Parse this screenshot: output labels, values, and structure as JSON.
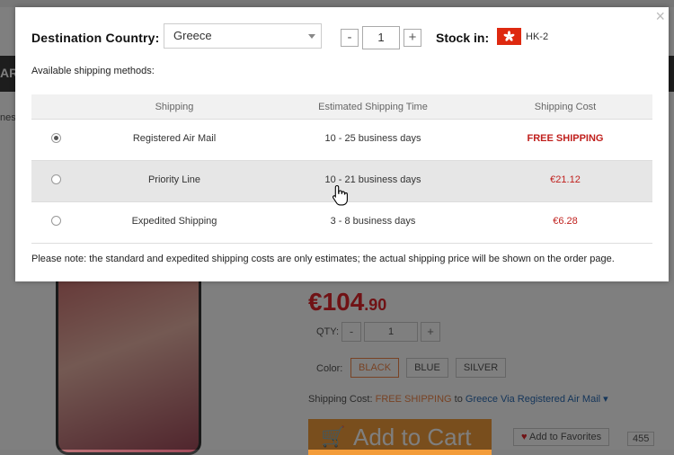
{
  "background": {
    "nav_text": "ART",
    "breadcrumb_text": "nes",
    "price_main": "€104",
    "price_cents": ".90",
    "qty_label": "QTY:",
    "qty_minus": "-",
    "qty_value": "1",
    "qty_plus": "+",
    "color_label": "Color:",
    "colors": [
      "BLACK",
      "BLUE",
      "SILVER"
    ],
    "shipping_label": "Shipping Cost:",
    "shipping_free": "FREE SHIPPING",
    "shipping_to": "to",
    "shipping_method": "Greece Via Registered Air Mail",
    "add_to_cart": "Add to Cart",
    "favorites": "Add to Favorites",
    "favorites_count": "455"
  },
  "modal": {
    "close_icon": "×",
    "destination_label": "Destination Country:",
    "country_value": "Greece",
    "qty_minus": "-",
    "qty_value": "1",
    "qty_plus": "+",
    "stock_label": "Stock in:",
    "stock_code": "HK-2",
    "available_label": "Available shipping methods:",
    "columns": [
      "Shipping",
      "Estimated Shipping Time",
      "Shipping Cost"
    ],
    "rows": [
      {
        "name": "Registered Air Mail",
        "time": "10 - 25 business days",
        "cost": "FREE SHIPPING",
        "selected": true
      },
      {
        "name": "Priority Line",
        "time": "10 - 21 business days",
        "cost": "€21.12",
        "selected": false
      },
      {
        "name": "Expedited Shipping",
        "time": "3 - 8 business days",
        "cost": "€6.28",
        "selected": false
      }
    ],
    "note": "Please note: the standard and expedited shipping costs are only estimates; the actual shipping price will be shown on the order page."
  },
  "colors": {
    "price_red": "#c0201d",
    "accent_orange": "#f39c3a",
    "flag_red": "#de2910"
  }
}
